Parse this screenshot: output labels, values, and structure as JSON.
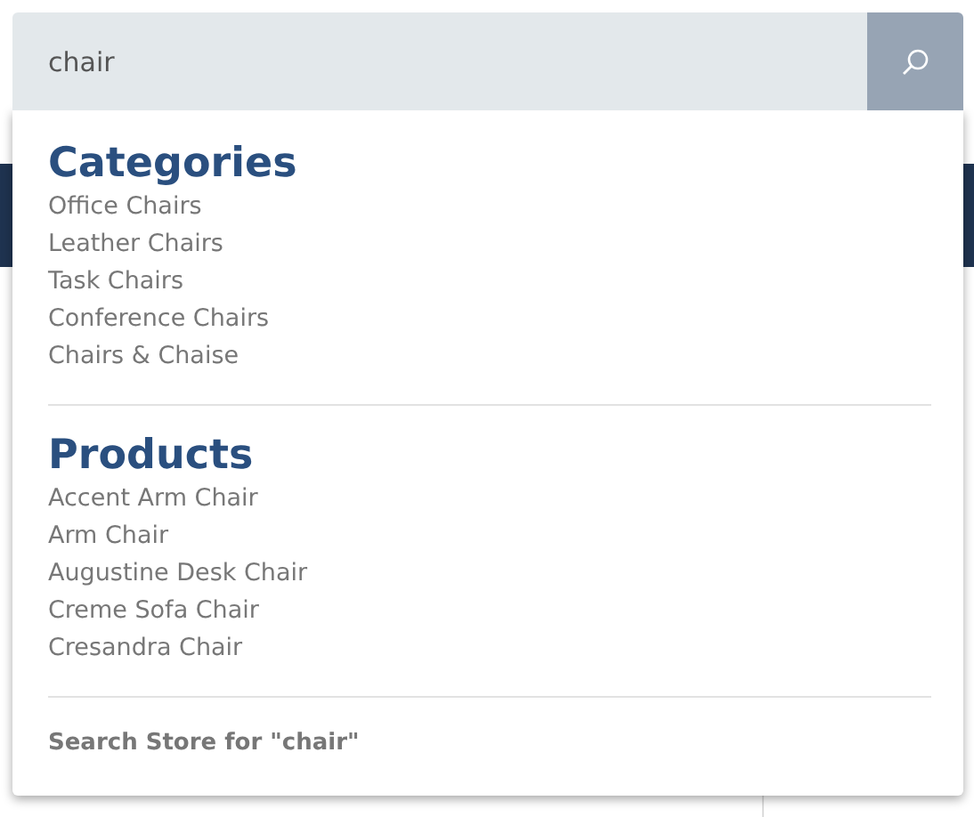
{
  "search": {
    "value": "chair"
  },
  "sections": [
    {
      "title": "Categories",
      "items": [
        "Office Chairs",
        "Leather Chairs",
        "Task Chairs",
        "Conference Chairs",
        "Chairs & Chaise"
      ]
    },
    {
      "title": "Products",
      "items": [
        "Accent Arm Chair",
        "Arm Chair",
        "Augustine Desk Chair",
        "Creme Sofa Chair",
        "Cresandra Chair"
      ]
    }
  ],
  "footer_link": "Search Store for \"chair\""
}
